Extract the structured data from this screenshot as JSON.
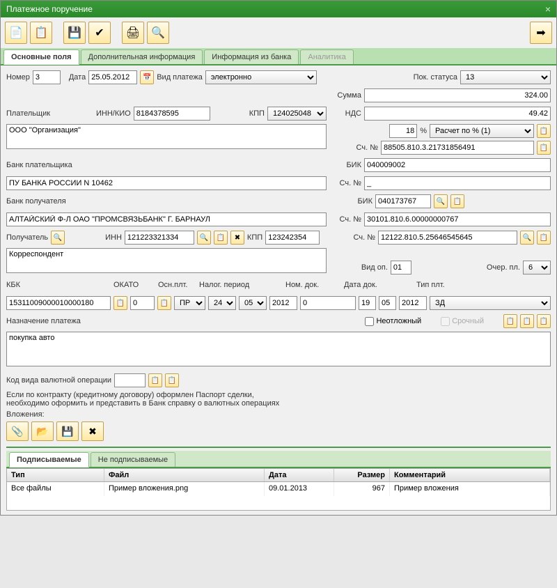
{
  "window": {
    "title": "Платежное поручение"
  },
  "tabs": {
    "main": "Основные поля",
    "extra": "Дополнительная информация",
    "bank": "Информация из банка",
    "analytics": "Аналитика"
  },
  "labels": {
    "number": "Номер",
    "date": "Дата",
    "payment_type": "Вид платежа",
    "status": "Пок. статуса",
    "sum": "Сумма",
    "payer": "Плательщик",
    "inn_kio": "ИНН/КИО",
    "kpp": "КПП",
    "nds": "НДС",
    "percent": "%",
    "acc_no": "Сч. №",
    "payer_bank": "Банк плательщика",
    "bik": "БИК",
    "payee_bank": "Банк получателя",
    "payee": "Получатель",
    "inn": "ИНН",
    "op_type": "Вид оп.",
    "queue": "Очер. пл.",
    "kbk": "КБК",
    "okato": "ОКАТО",
    "osn": "Осн.плт.",
    "tax_period": "Налог. период",
    "doc_no": "Ном. док.",
    "doc_date": "Дата док.",
    "pay_type": "Тип плт.",
    "purpose": "Назначение платежа",
    "urgent": "Неотложный",
    "term": "Срочный",
    "currency_code": "Код вида валютной операции",
    "passport_note1": "Если по контракту (кредитному договору) оформлен Паспорт сделки,",
    "passport_note2": "необходимо оформить и представить в Банк справку о валютных операциях",
    "attachments": "Вложения:",
    "signable": "Подписываемые",
    "not_signable": "Не подписываемые"
  },
  "values": {
    "number": "3",
    "date": "25.05.2012",
    "payment_type": "электронно",
    "status": "13",
    "sum": "324.00",
    "inn_kio": "8184378595",
    "kpp_payer": "124025048",
    "nds": "49.42",
    "nds_pct": "18",
    "nds_calc": "Расчет по % (1)",
    "payer_name": "ООО \"Организация\"",
    "payer_acc": "88505.810.3.21731856491",
    "payer_bank_bik": "040009002",
    "payer_bank_name": "ПУ БАНКА РОССИИ N 10462",
    "payer_bank_acc": "_",
    "payee_bank_bik": "040173767",
    "payee_bank_name": "АЛТАЙСКИЙ Ф-Л ОАО \"ПРОМСВЯЗЬБАНК\" Г. БАРНАУЛ",
    "payee_bank_acc": "30101.810.6.00000000767",
    "payee_inn": "121223321334",
    "payee_kpp": "123242354",
    "payee_acc": "12122.810.5.25646545645",
    "payee_name": "Корреспондент",
    "op_type": "01",
    "queue": "6",
    "kbk": "15311009000010000180",
    "okato": "0",
    "osn": "ПР",
    "tax_d": "24",
    "tax_m": "05",
    "tax_y": "2012",
    "doc_no": "0",
    "doc_d": "19",
    "doc_m": "05",
    "doc_y": "2012",
    "pay_type": "ЗД",
    "purpose": "покупка авто",
    "currency_code": ""
  },
  "grid": {
    "headers": {
      "type": "Тип",
      "file": "Файл",
      "date": "Дата",
      "size": "Размер",
      "comment": "Комментарий"
    },
    "rows": [
      {
        "type": "Все файлы",
        "file": "Пример вложения.png",
        "date": "09.01.2013",
        "size": "967",
        "comment": "Пример вложения"
      }
    ]
  }
}
